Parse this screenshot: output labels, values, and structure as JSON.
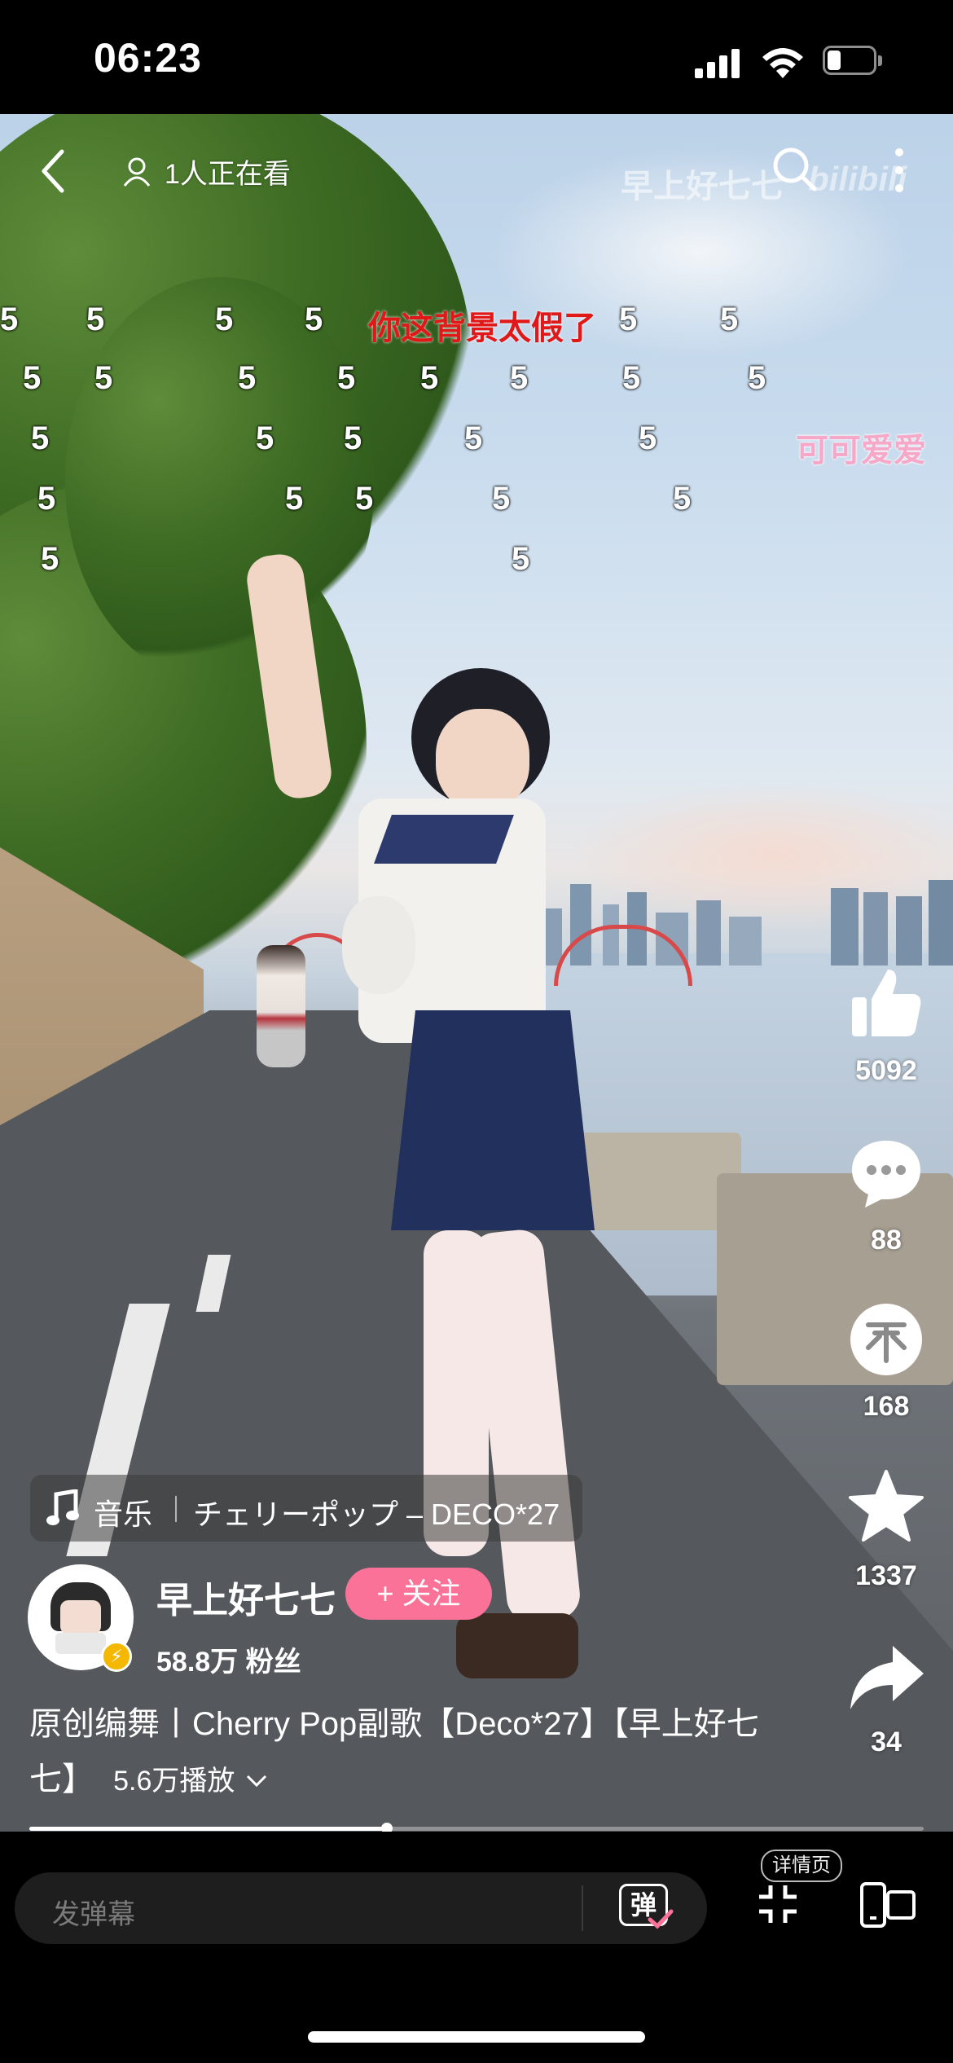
{
  "status_bar": {
    "time": "06:23"
  },
  "top_bar": {
    "viewers": "1人正在看",
    "watermark_author": "早上好七七",
    "watermark_logo": "bilibili"
  },
  "danmaku": {
    "red_comment": "你这背景太假了",
    "pink_comment": "可可爱爱",
    "digit": "5"
  },
  "music": {
    "icon": "music-note-icon",
    "label": "音乐",
    "song": "チェリーポップ – DECO*27"
  },
  "author": {
    "name": "早上好七七",
    "fans": "58.8万 粉丝",
    "follow_label": "+ 关注"
  },
  "video": {
    "title": "原创编舞丨Cherry Pop副歌【Deco*27】【早上好七七】",
    "plays": "5.6万播放",
    "progress": 0.4
  },
  "actions": {
    "like": "5092",
    "comment": "88",
    "coin": "168",
    "favorite": "1337",
    "share": "34"
  },
  "bottom": {
    "input_placeholder": "发弹幕",
    "danmaku_icon": "弹",
    "detail_label": "详情页"
  },
  "colors": {
    "follow_pink": "#fb7299",
    "danmaku_red": "#e01818",
    "danmaku_pink": "#f6a8c8"
  }
}
